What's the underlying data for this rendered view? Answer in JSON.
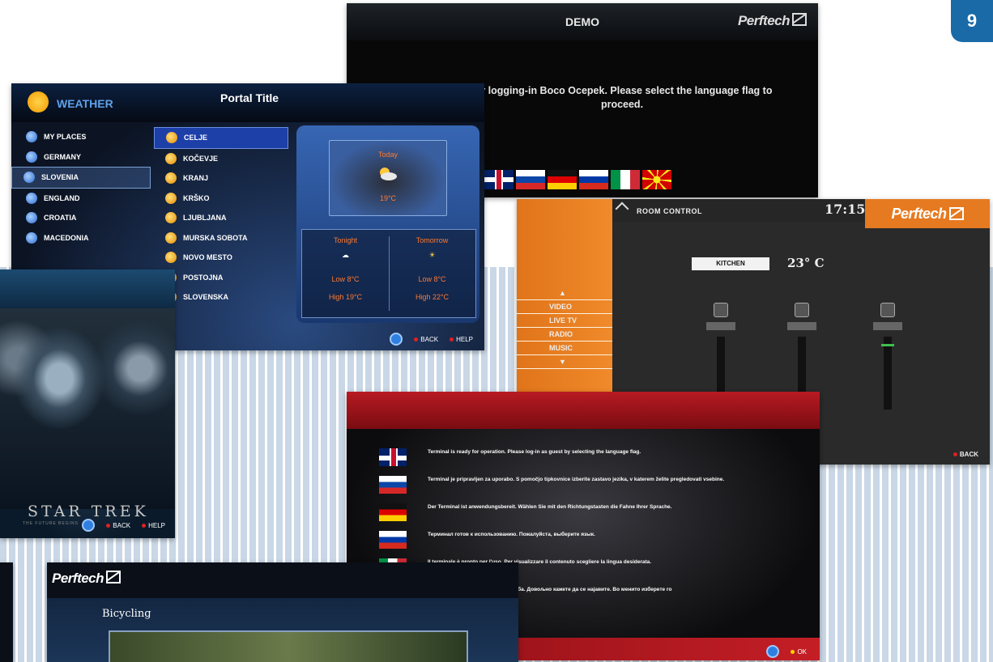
{
  "page_number": "9",
  "demo": {
    "title": "DEMO",
    "logo": "Perftech",
    "message": "for logging-in Boco Ocepek. Please select the language flag to proceed.",
    "flags": [
      "uk",
      "si",
      "de",
      "ru",
      "it",
      "mk"
    ]
  },
  "weather": {
    "app_name": "WEATHER",
    "portal_title": "Portal Title",
    "regions": [
      "MY PLACES",
      "GERMANY",
      "SLOVENIA",
      "ENGLAND",
      "CROATIA",
      "MACEDONIA"
    ],
    "selected_region": "SLOVENIA",
    "cities": [
      "CELJE",
      "KOČEVJE",
      "KRANJ",
      "KRŠKO",
      "LJUBLJANA",
      "MURSKA SOBOTA",
      "NOVO MESTO",
      "POSTOJNA",
      "SLOVENSKA"
    ],
    "selected_city": "CELJE",
    "today": {
      "label": "Today",
      "temp": "19°C"
    },
    "forecast": [
      {
        "day": "Tonight",
        "low": "Low 8°C",
        "high": "High 19°C"
      },
      {
        "day": "Tomorrow",
        "low": "Low 8°C",
        "high": "High 22°C"
      }
    ],
    "footer": {
      "back": "BACK",
      "help": "HELP"
    }
  },
  "movie": {
    "poster_title": "STAR TREK",
    "poster_subtitle": "THE FUTURE BEGINS",
    "footer": {
      "back": "BACK",
      "help": "HELP"
    }
  },
  "room_control": {
    "title": "ROOM CONTROL",
    "time": "17:15",
    "logo": "Perftech",
    "menu": [
      "VIDEO",
      "LIVE TV",
      "RADIO",
      "MUSIC"
    ],
    "room": "KITCHEN",
    "temperature": "23° C",
    "sliders": [
      {
        "name": "slider-1",
        "level": 0.0
      },
      {
        "name": "slider-2",
        "level": 0.0
      },
      {
        "name": "slider-3",
        "level": 0.9
      }
    ],
    "back": "BACK"
  },
  "terminal": {
    "languages": [
      {
        "flag": "uk",
        "text": "Terminal is ready for operation. Please log-in as guest by selecting the language flag."
      },
      {
        "flag": "si",
        "text": "Terminal je pripravljen za uporabo. S pomočjo tipkovnice izberite zastavo jezika, v katerem želite pregledovati vsebine."
      },
      {
        "flag": "de",
        "text": "Der Terminal ist anwendungsbereit. Wählen Sie mit den Richtungstasten die Fahne Ihrer Sprache."
      },
      {
        "flag": "ru",
        "text": "Терминал готов к использованию. Пожалуйста, выберите язык."
      },
      {
        "flag": "it",
        "text": "Il terminale è pronto per l'uso. Per visualizzare il contenuto scegliere la lingua desiderata."
      },
      {
        "flag": "mk",
        "text": "Терминалот е подготвен за употреба. Довољно кажете да се најавите. Во менито изберете го"
      }
    ],
    "ok": "OK"
  },
  "video": {
    "logo": "Perftech",
    "title": "Bicycling"
  }
}
